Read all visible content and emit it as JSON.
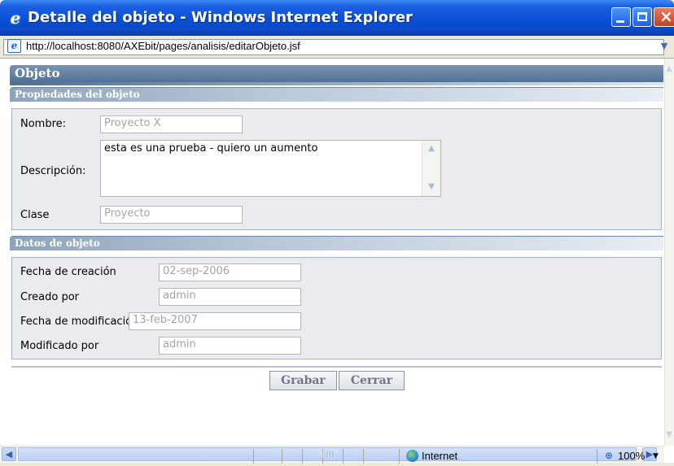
{
  "window": {
    "title": "Detalle del objeto - Windows Internet Explorer",
    "address": "http://localhost:8080/AXEbit/pages/analisis/editarObjeto.jsf"
  },
  "page": {
    "section_title": "Objeto",
    "properties": {
      "header": "Propiedades del objeto",
      "nombre_label": "Nombre:",
      "nombre_value": "Proyecto X",
      "descripcion_label": "Descripción:",
      "descripcion_value": "esta es una prueba - quiero un aumento",
      "clase_label": "Clase",
      "clase_value": "Proyecto"
    },
    "data": {
      "header": "Datos de objeto",
      "fecha_creacion_label": "Fecha de creación",
      "fecha_creacion_value": "02-sep-2006",
      "creado_por_label": "Creado por",
      "creado_por_value": "admin",
      "fecha_modificacion_label": "Fecha de modificación",
      "fecha_modificacion_value": "13-feb-2007",
      "modificado_por_label": "Modificado por",
      "modificado_por_value": "admin"
    },
    "buttons": {
      "grabar": "Grabar",
      "cerrar": "Cerrar"
    }
  },
  "statusbar": {
    "zone": "Internet",
    "zoom": "100%"
  },
  "icons": {
    "title": "ie-logo-icon",
    "page": "ie-page-icon",
    "zone": "globe-icon",
    "zoom": "magnifier-icon"
  },
  "colors": {
    "titlebar": "#0a4fd6",
    "section_header": "#5b7a9c",
    "panel_bg": "#e9ebee"
  }
}
